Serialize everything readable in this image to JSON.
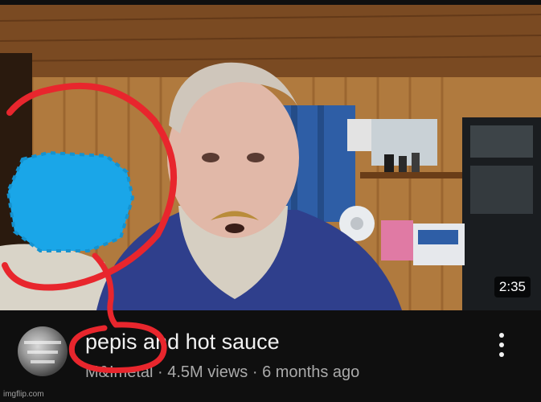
{
  "video": {
    "duration": "2:35"
  },
  "details": {
    "title": "pepis and hot sauce",
    "channel": "M&Imetal",
    "views": "4.5M views",
    "age": "6 months ago",
    "separator": " · "
  },
  "watermark": "imgflip.com",
  "colors": {
    "annotation_red": "#e8262d",
    "censor_blue": "#1aa6e8",
    "background": "#0f0f0f",
    "meta_text": "#aaaaaa"
  },
  "icons": {
    "more": "kebab-vertical-dots"
  }
}
